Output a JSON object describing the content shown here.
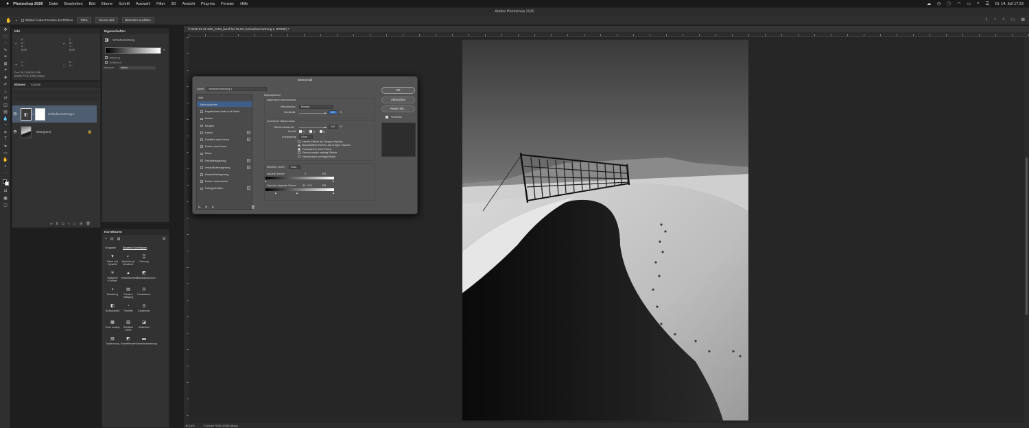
{
  "menubar": {
    "apple": "",
    "app": "Photoshop 2026",
    "items": [
      "Datei",
      "Bearbeiten",
      "Bild",
      "Ebene",
      "Schrift",
      "Auswahl",
      "Filter",
      "3D",
      "Ansicht",
      "Plug-ins",
      "Fenster",
      "Hilfe"
    ],
    "datetime": "Di. 14. Juli 17:23"
  },
  "titlebar": {
    "title": "Adobe Photoshop 2026"
  },
  "optionsbar": {
    "scroll_all_windows": "Bildlauf in allen Fenstern durchführen",
    "zoom_100": "100%",
    "fit_screen": "Ganzes Bild",
    "fill_screen": "Bildschirm ausfüllen"
  },
  "info_panel": {
    "tab": "Info",
    "r_label": "R :",
    "g_label": "G :",
    "b_label": "B :",
    "bit": "8-Bit",
    "x_label": "X :",
    "y_label": "Y :",
    "b_label2": "B :",
    "h_label": "H :",
    "doc": "Dok: 38,2 MB/28,3 MB",
    "profile": "Adobe RGB (1998) (8bpc)"
  },
  "properties_panel": {
    "tab": "Eigenschaften",
    "type": "Verlaufsumsetzung",
    "dither": "Dithering",
    "reverse": "Umkehren",
    "method_label": "Methode:",
    "method_value": "Weich"
  },
  "layers_panel": {
    "tab": "Ebenen",
    "tab2": "Kanäle",
    "layers": [
      {
        "name": "Verlaufsumsetzung 1"
      },
      {
        "name": "Hintergrund"
      }
    ]
  },
  "corrections_panel": {
    "tab": "Korrekturen",
    "subtab1": "Vorgaben",
    "subtab2": "Einzelne Korrekturen",
    "items": [
      {
        "label": "Farbe und Dynamik",
        "icon": "▼"
      },
      {
        "label": "Klarheit und Dunstentf.",
        "icon": "◐"
      },
      {
        "label": "Körnung",
        "icon": "▒"
      },
      {
        "label": "Helligkeit/ Kontrast",
        "icon": "✳"
      },
      {
        "label": "Tonwertkorrektur",
        "icon": "▲"
      },
      {
        "label": "Gradationskurven",
        "icon": "◩"
      },
      {
        "label": "Belichtung",
        "icon": "◑"
      },
      {
        "label": "Farbton/ Sättigung",
        "icon": "▤"
      },
      {
        "label": "Farbbalance",
        "icon": "⚖"
      },
      {
        "label": "Schwarzweiß",
        "icon": "◧"
      },
      {
        "label": "Fotofilter",
        "icon": "◔"
      },
      {
        "label": "Kanalmixer",
        "icon": "◎"
      },
      {
        "label": "Color Lookup",
        "icon": "▦"
      },
      {
        "label": "Selektive Farbe",
        "icon": "▥"
      },
      {
        "label": "Umkehren",
        "icon": "◪"
      },
      {
        "label": "Tontrennung",
        "icon": "▨"
      },
      {
        "label": "Schwellenwert",
        "icon": "◩"
      },
      {
        "label": "Verlaufsumsetzung",
        "icon": "▬"
      }
    ]
  },
  "document": {
    "tab": "© 2026-01-31-IMG_0153_bw.tif bei 39,2% (Verlaufsumsetzung 1, RGB/8*) *",
    "zoom": "39,16%",
    "status": "© Adobe RGB (1998) (8bpc)"
  },
  "dialog": {
    "title": "Ebenenstil",
    "name_label": "Name:",
    "name_value": "Verlaufsumsetzung 1",
    "styles_label": "Stile",
    "fx_items": [
      {
        "label": "Mischoptionen",
        "cb": false,
        "plus": false
      },
      {
        "label": "Abgeflachte Kante und Relief",
        "cb": true,
        "plus": false
      },
      {
        "label": "Kontur",
        "cb": true,
        "plus": false
      },
      {
        "label": "Struktur",
        "cb": true,
        "plus": false
      },
      {
        "label": "Kontur",
        "cb": true,
        "plus": true
      },
      {
        "label": "Schatten nach innen",
        "cb": true,
        "plus": true
      },
      {
        "label": "Schein nach innen",
        "cb": true,
        "plus": false
      },
      {
        "label": "Glanz",
        "cb": true,
        "plus": false
      },
      {
        "label": "Farbüberlagerung",
        "cb": true,
        "plus": true
      },
      {
        "label": "Verlaufsüberlagerung",
        "cb": true,
        "plus": true
      },
      {
        "label": "Musterüberlagerung",
        "cb": true,
        "plus": false
      },
      {
        "label": "Schein nach außen",
        "cb": true,
        "plus": false
      },
      {
        "label": "Schlagschatten",
        "cb": true,
        "plus": true
      }
    ],
    "blend_options": "Mischoptionen",
    "general_blending": "Allgemeiner Mischmodus",
    "blend_mode_label": "Mischmodus:",
    "blend_mode_value": "Normal",
    "opacity_label": "Deckkraft:",
    "opacity_value": "100",
    "percent": "%",
    "advanced_blending": "Erweiterter Mischmodus",
    "fill_opacity_label": "Flächendeckkraft:",
    "fill_opacity_value": "100",
    "channels_label": "Kanäle:",
    "ch_r": "R",
    "ch_g": "G",
    "ch_b": "B",
    "knockout_label": "Aussparung:",
    "knockout_value": "Ohne",
    "opt1": "Interne Effekte als Gruppe mischen",
    "opt2": "Beschnittene Ebenen als Gruppe mischen",
    "opt3": "Transparenz formt Ebene",
    "opt4": "Ebenenmaske verbirgt Effekte",
    "opt5": "Vektormaske verbirgt Effekte",
    "blend_if_label": "Mischen, wenn:",
    "blend_if_value": "Grau",
    "this_layer": "Aktuelle Ebene:",
    "this_low": "0",
    "this_high": "255",
    "underlying": "Darunter liegende Ebene:",
    "under_vals": "83 / 174",
    "under_high": "255",
    "ok": "OK",
    "cancel": "Abbrechen",
    "new_style": "Neuer Stil...",
    "preview": "Vorschau"
  }
}
